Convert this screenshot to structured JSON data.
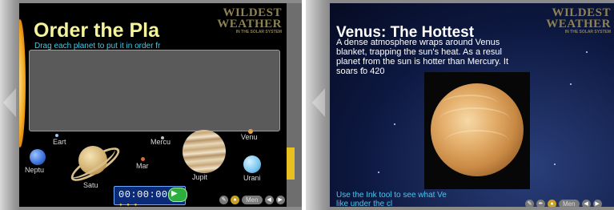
{
  "left_screen": {
    "title": "Order the Pla",
    "subtitle": "Drag each planet to put it in order fr",
    "logo": {
      "line1": "WILDEST",
      "line2": "WEATHER",
      "line3": "IN THE SOLAR SYSTEM"
    },
    "planets": [
      {
        "label": "Eart"
      },
      {
        "label": "Neptu"
      },
      {
        "label": "Satu"
      },
      {
        "label": "Mercu"
      },
      {
        "label": "Mar"
      },
      {
        "label": "Jupit"
      },
      {
        "label": "Venu"
      },
      {
        "label": "Urani"
      }
    ],
    "timer": {
      "value": "00:00:00"
    },
    "menu_label": "Men"
  },
  "right_screen": {
    "title": "Venus: The Hottest",
    "body_lines": [
      "A dense atmosphere wraps around Venus",
      "blanket, trapping the sun's heat. As a resul",
      "planet from the sun is hotter than Mercury. It",
      "soars to 420"
    ],
    "hint_lines": [
      "Use the Ink tool to see what Ve",
      "like under the cl"
    ],
    "logo": {
      "line1": "WILDEST",
      "line2": "WEATHER",
      "line3": "IN THE SOLAR SYSTEM"
    },
    "menu_label": "Men"
  },
  "icons": {
    "prev": "arrow-left-icon",
    "next": "arrow-right-icon",
    "play": "play-icon",
    "tools": "tools-icon"
  },
  "colors": {
    "title_yellow": "#f5f39c",
    "subtitle_cyan": "#3ad0f0",
    "timer_blue": "#0b2b78",
    "slide_bg": "#0d1840"
  }
}
